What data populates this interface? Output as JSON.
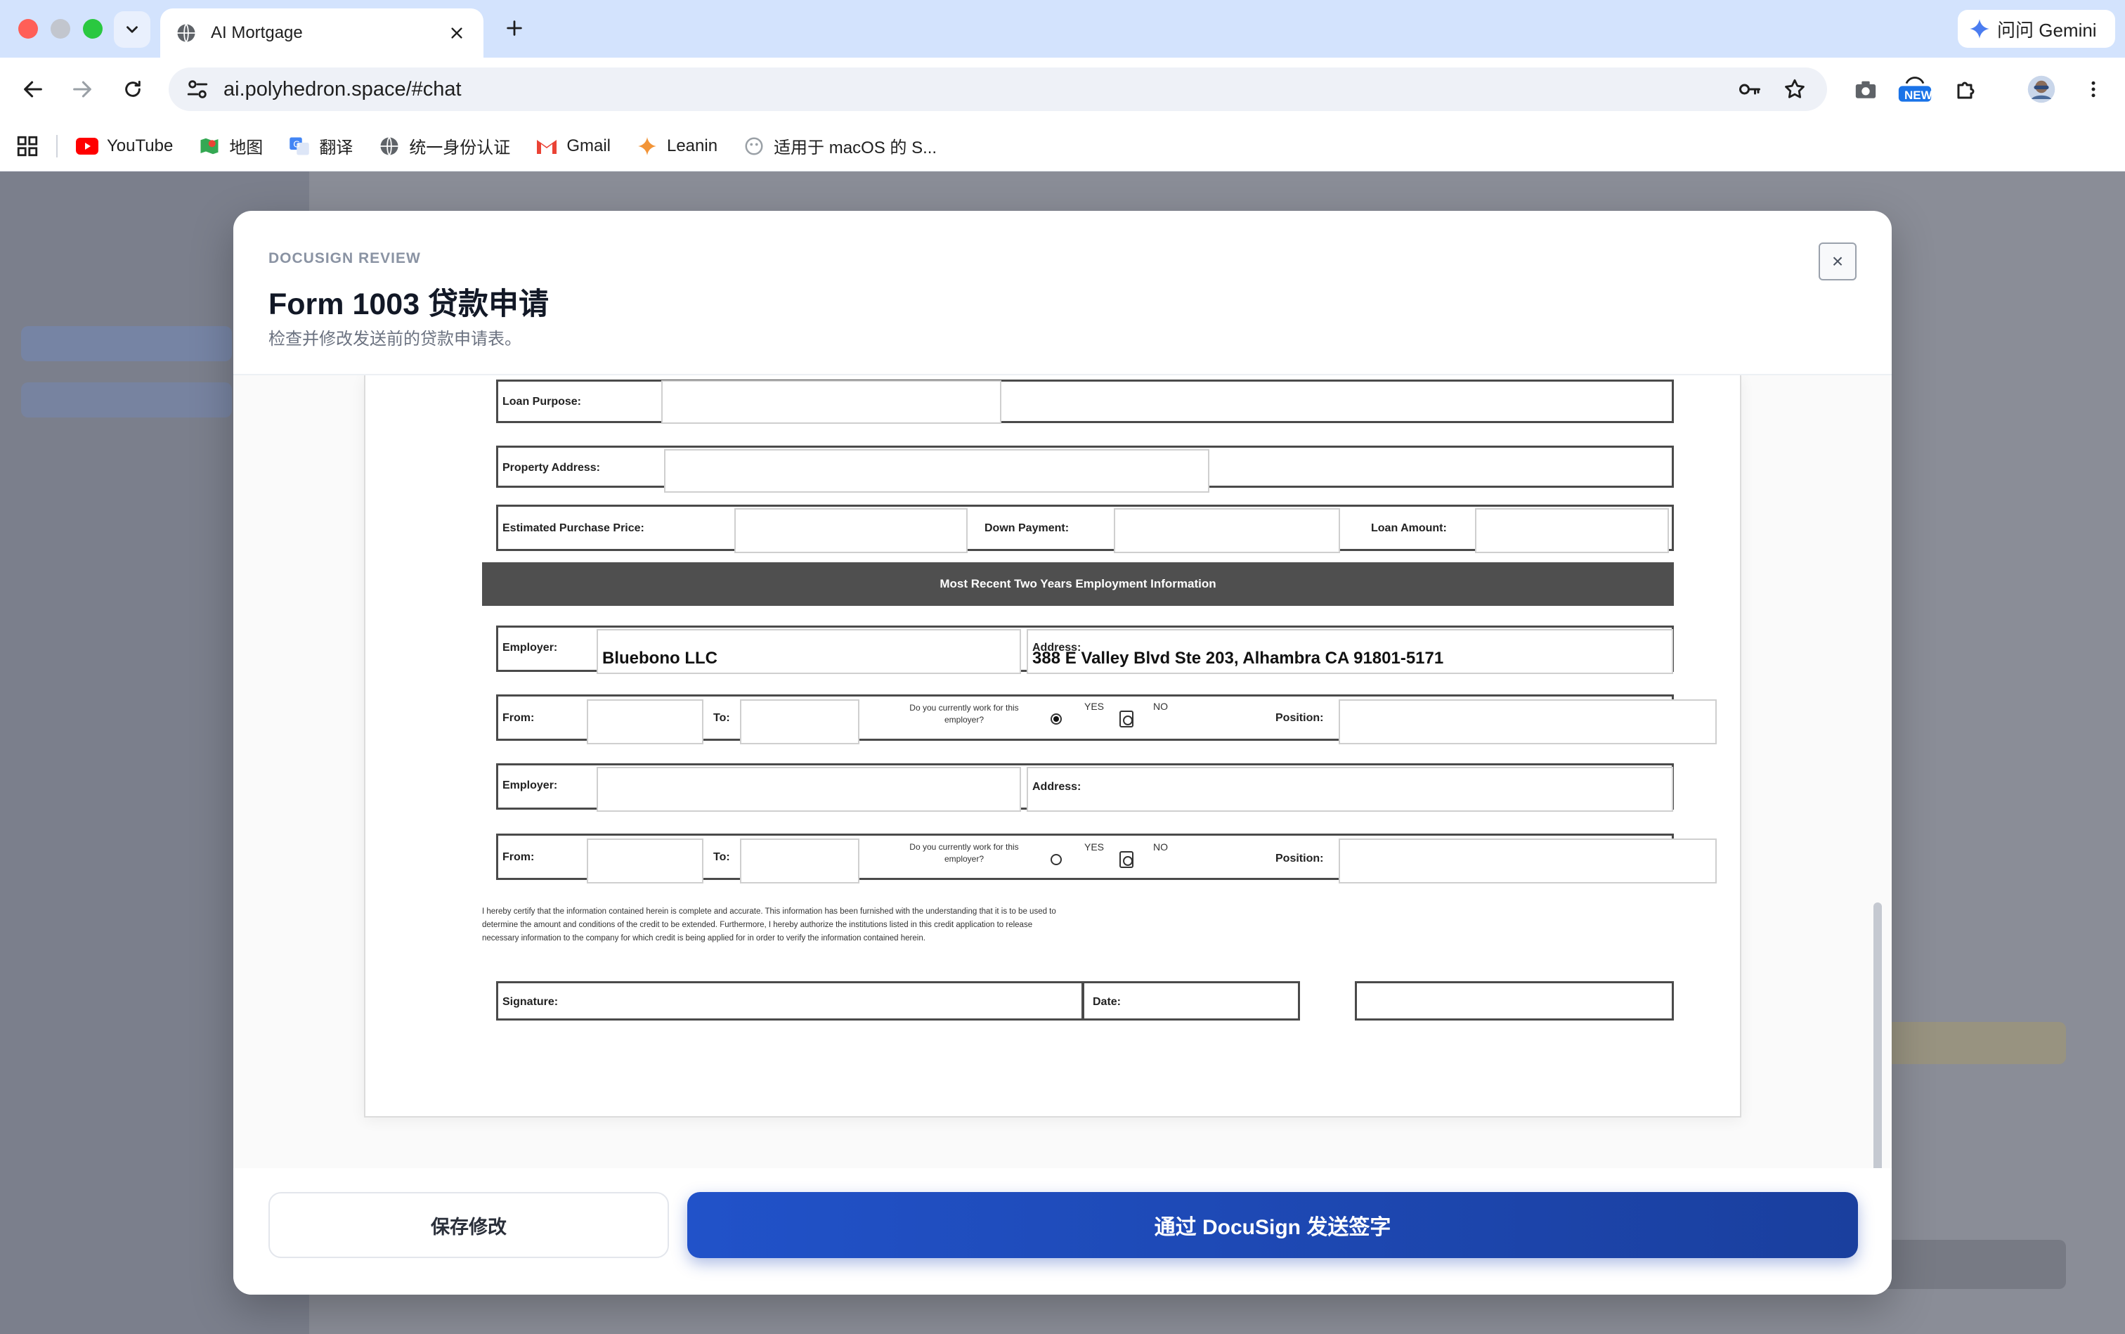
{
  "browser": {
    "tab_title": "AI Mortgage",
    "url": "ai.polyhedron.space/#chat",
    "gemini_label": "问问 Gemini",
    "new_badge": "NEW",
    "bookmarks": [
      {
        "label": "YouTube",
        "icon": "youtube-icon"
      },
      {
        "label": "地图",
        "icon": "maps-icon"
      },
      {
        "label": "翻译",
        "icon": "translate-icon"
      },
      {
        "label": "统一身份认证",
        "icon": "globe-icon"
      },
      {
        "label": "Gmail",
        "icon": "gmail-icon"
      },
      {
        "label": "Leanin",
        "icon": "sparkle-icon"
      },
      {
        "label": "适用于 macOS 的 S...",
        "icon": "app-icon"
      }
    ]
  },
  "modal": {
    "eyebrow": "DOCUSIGN REVIEW",
    "title": "Form 1003 贷款申请",
    "subtitle": "检查并修改发送前的贷款申请表。",
    "close_label": "×",
    "save_button": "保存修改",
    "send_button": "通过 DocuSign 发送签字"
  },
  "form": {
    "loan_purpose_label": "Loan Purpose:",
    "loan_purpose_value": "",
    "property_address_label": "Property Address:",
    "property_address_value": "",
    "estimated_price_label": "Estimated Purchase Price:",
    "down_payment_label": "Down Payment:",
    "loan_amount_label": "Loan Amount:",
    "section_title": "Most Recent Two Years Employment Information",
    "employment": [
      {
        "employer_label": "Employer:",
        "employer_value": "Bluebono LLC",
        "address_label": "Address:",
        "address_value": "388 E Valley Blvd Ste 203, Alhambra CA 91801-5171",
        "from_label": "From:",
        "to_label": "To:",
        "question": "Do you currently work for this employer?",
        "yes_label": "YES",
        "no_label": "NO",
        "yes_selected": true,
        "position_label": "Position:"
      },
      {
        "employer_label": "Employer:",
        "employer_value": "",
        "address_label": "Address:",
        "address_value": "",
        "from_label": "From:",
        "to_label": "To:",
        "question": "Do you currently work for this employer?",
        "yes_label": "YES",
        "no_label": "NO",
        "yes_selected": false,
        "position_label": "Position:"
      }
    ],
    "certification": "I hereby certify that the information contained herein is complete and accurate. This information has been furnished with the understanding that it is to be used to determine the amount and conditions of the credit to be extended. Furthermore, I hereby authorize the institutions listed in this credit application to release necessary information to the company for which credit is being applied for in order to verify the information contained herein.",
    "signature_label": "Signature:",
    "date_label": "Date:"
  }
}
